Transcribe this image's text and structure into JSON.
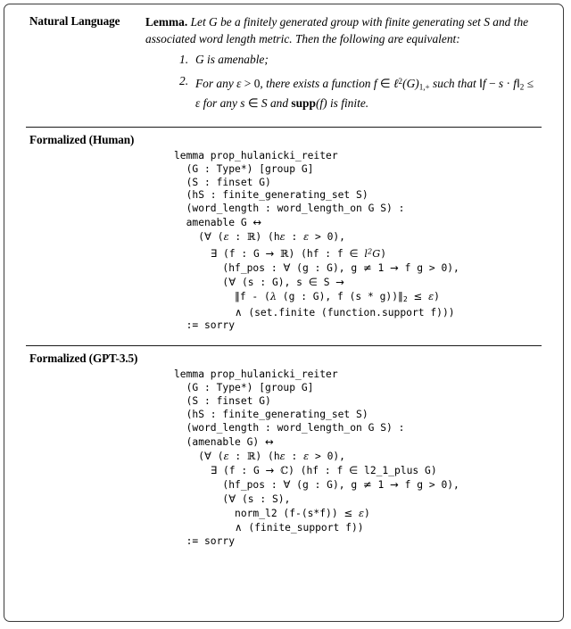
{
  "figure": {
    "border_color": "#3a3a3a",
    "divider_color": "#1a1a1a",
    "background": "#ffffff"
  },
  "rows": [
    {
      "label": "Natural Language",
      "kind": "prose"
    },
    {
      "label": "Formalized (Human)",
      "kind": "code"
    },
    {
      "label": "Formalized (GPT-3.5)",
      "kind": "code"
    }
  ],
  "natural_language": {
    "label": "Natural Language",
    "lead": "Lemma.",
    "statement": "Let G be a finitely generated group with finite generating set S and the associated word length metric. Then the following are equivalent:",
    "items": [
      {
        "marker": "1.",
        "text": "G is amenable;"
      },
      {
        "marker": "2.",
        "text": "For any ε > 0, there exists a function f ∈ ℓ2(G)1,+ such that ‖f − s · f‖2 ≤ ε for any s ∈ S and supp(f) is finite."
      }
    ]
  },
  "formalized_human": {
    "label": "Formalized (Human)",
    "lines": [
      "lemma prop_hulanicki_reiter",
      "  (G : Type*) [group G]",
      "  (S : finset G)",
      "  (hS : finite_generating_set S)",
      "  (word_length : word_length_on G S) :",
      "  amenable G ↔",
      "    (∀ (ε : ℝ) (hε : ε > 0),",
      "      ∃ (f : G → ℝ) (hf : f ∈ l²G)",
      "        (hf_pos : ∀ (g : G), g ≠ 1 → f g > 0),",
      "        (∀ (s : G), s ∈ S →",
      "          ‖f - (λ (g : G), f (s * g))‖2 ≤ ε)",
      "          ∧ (set.finite (function.support f)))",
      "  := sorry"
    ]
  },
  "formalized_gpt": {
    "label": "Formalized (GPT-3.5)",
    "lines": [
      "lemma prop_hulanicki_reiter",
      "  (G : Type*) [group G]",
      "  (S : finset G)",
      "  (hS : finite_generating_set S)",
      "  (word_length : word_length_on G S) :",
      "  (amenable G) ↔",
      "    (∀ (ε : ℝ) (hε : ε > 0),",
      "      ∃ (f : G → ℂ) (hf : f ∈ l2_1_plus G)",
      "        (hf_pos : ∀ (g : G), g ≠ 1 → f g > 0),",
      "        (∀ (s : S),",
      "          norm_l2 (f-(s*f)) ≤ ε)",
      "          ∧ (finite_support f))",
      "  := sorry"
    ]
  }
}
